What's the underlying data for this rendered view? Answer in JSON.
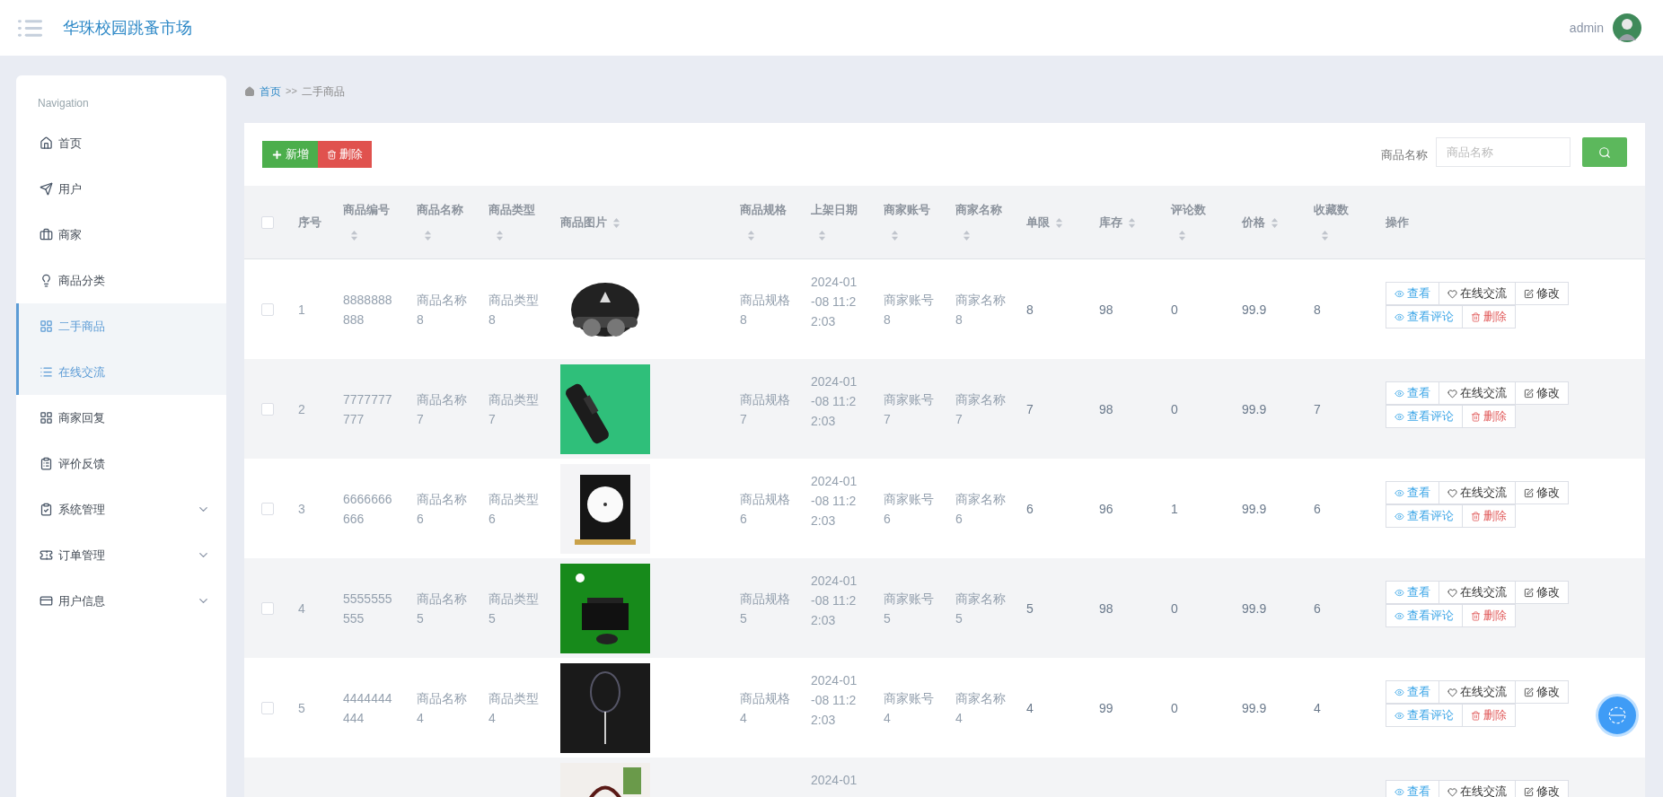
{
  "header": {
    "title": "华珠校园跳蚤市场",
    "user": "admin"
  },
  "breadcrumb": {
    "home": "首页",
    "separator": ">>",
    "current": "二手商品"
  },
  "sidebar": {
    "heading": "Navigation",
    "items": [
      {
        "label": "首页",
        "selected": false,
        "expandable": false
      },
      {
        "label": "用户",
        "selected": false,
        "expandable": false
      },
      {
        "label": "商家",
        "selected": false,
        "expandable": false
      },
      {
        "label": "商品分类",
        "selected": false,
        "expandable": false
      },
      {
        "label": "二手商品",
        "selected": true,
        "expandable": false
      },
      {
        "label": "在线交流",
        "selected": true,
        "expandable": false
      },
      {
        "label": "商家回复",
        "selected": false,
        "expandable": false
      },
      {
        "label": "评价反馈",
        "selected": false,
        "expandable": false
      },
      {
        "label": "系统管理",
        "selected": false,
        "expandable": true
      },
      {
        "label": "订单管理",
        "selected": false,
        "expandable": true
      },
      {
        "label": "用户信息",
        "selected": false,
        "expandable": true
      }
    ]
  },
  "toolbar": {
    "add": "新增",
    "delete": "删除",
    "search_label": "商品名称",
    "search_placeholder": "商品名称"
  },
  "table": {
    "all_checked": false,
    "columns": [
      {
        "label": "序号",
        "sortable": false
      },
      {
        "label": "商品编号",
        "sortable": true
      },
      {
        "label": "商品名称",
        "sortable": true
      },
      {
        "label": "商品类型",
        "sortable": true
      },
      {
        "label": "商品图片",
        "sortable": true
      },
      {
        "label": "商品规格",
        "sortable": true
      },
      {
        "label": "上架日期",
        "sortable": true
      },
      {
        "label": "商家账号",
        "sortable": true
      },
      {
        "label": "商家名称",
        "sortable": true
      },
      {
        "label": "单限",
        "sortable": true
      },
      {
        "label": "库存",
        "sortable": true
      },
      {
        "label": "评论数",
        "sortable": true
      },
      {
        "label": "价格",
        "sortable": true
      },
      {
        "label": "收藏数",
        "sortable": true
      },
      {
        "label": "操作",
        "sortable": false
      }
    ],
    "rows": [
      {
        "checked": false,
        "cells": [
          "1",
          "8888888888",
          "商品名称8",
          "商品类型8",
          {
            "kind": "picture"
          },
          "商品规格8",
          "2024-01-08 11:22:03",
          "商家账号8",
          "商家名称8",
          "8",
          "98",
          "0",
          "99.9",
          "8",
          {
            "kind": "actions",
            "items": [
              {
                "kind": "view",
                "label": "查看"
              },
              {
                "kind": "chat",
                "label": "在线交流"
              },
              {
                "kind": "edit",
                "label": "修改"
              },
              {
                "kind": "view",
                "label": "查看评论"
              },
              {
                "kind": "delete",
                "label": "删除"
              }
            ]
          }
        ]
      },
      {
        "checked": false,
        "cells": [
          "2",
          "7777777777",
          "商品名称7",
          "商品类型7",
          {
            "kind": "picture"
          },
          "商品规格7",
          "2024-01-08 11:22:03",
          "商家账号7",
          "商家名称7",
          "7",
          "98",
          "0",
          "99.9",
          "7",
          {
            "kind": "actions",
            "items": [
              {
                "kind": "view",
                "label": "查看"
              },
              {
                "kind": "chat",
                "label": "在线交流"
              },
              {
                "kind": "edit",
                "label": "修改"
              },
              {
                "kind": "view",
                "label": "查看评论"
              },
              {
                "kind": "delete",
                "label": "删除"
              }
            ]
          }
        ]
      },
      {
        "checked": false,
        "cells": [
          "3",
          "6666666666",
          "商品名称6",
          "商品类型6",
          {
            "kind": "picture"
          },
          "商品规格6",
          "2024-01-08 11:22:03",
          "商家账号6",
          "商家名称6",
          "6",
          "96",
          "1",
          "99.9",
          "6",
          {
            "kind": "actions",
            "items": [
              {
                "kind": "view",
                "label": "查看"
              },
              {
                "kind": "chat",
                "label": "在线交流"
              },
              {
                "kind": "edit",
                "label": "修改"
              },
              {
                "kind": "view",
                "label": "查看评论"
              },
              {
                "kind": "delete",
                "label": "删除"
              }
            ]
          }
        ]
      },
      {
        "checked": false,
        "cells": [
          "4",
          "5555555555",
          "商品名称5",
          "商品类型5",
          {
            "kind": "picture"
          },
          "商品规格5",
          "2024-01-08 11:22:03",
          "商家账号5",
          "商家名称5",
          "5",
          "98",
          "0",
          "99.9",
          "6",
          {
            "kind": "actions",
            "items": [
              {
                "kind": "view",
                "label": "查看"
              },
              {
                "kind": "chat",
                "label": "在线交流"
              },
              {
                "kind": "edit",
                "label": "修改"
              },
              {
                "kind": "view",
                "label": "查看评论"
              },
              {
                "kind": "delete",
                "label": "删除"
              }
            ]
          }
        ]
      },
      {
        "checked": false,
        "cells": [
          "5",
          "4444444444",
          "商品名称4",
          "商品类型4",
          {
            "kind": "picture"
          },
          "商品规格4",
          "2024-01-08 11:22:03",
          "商家账号4",
          "商家名称4",
          "4",
          "99",
          "0",
          "99.9",
          "4",
          {
            "kind": "actions",
            "items": [
              {
                "kind": "view",
                "label": "查看"
              },
              {
                "kind": "chat",
                "label": "在线交流"
              },
              {
                "kind": "edit",
                "label": "修改"
              },
              {
                "kind": "view",
                "label": "查看评论"
              },
              {
                "kind": "delete",
                "label": "删除"
              }
            ]
          }
        ]
      },
      {
        "cells": [
          null,
          null,
          null,
          null,
          {
            "kind": "picture"
          },
          null,
          "2024-01",
          null,
          null,
          null,
          null,
          null,
          null,
          null,
          {
            "kind": "actions",
            "items": [
              {
                "kind": "view",
                "label": "查看"
              },
              {
                "kind": "chat",
                "label": "在线交流"
              },
              {
                "kind": "edit",
                "label": "修改"
              }
            ]
          }
        ]
      }
    ]
  }
}
